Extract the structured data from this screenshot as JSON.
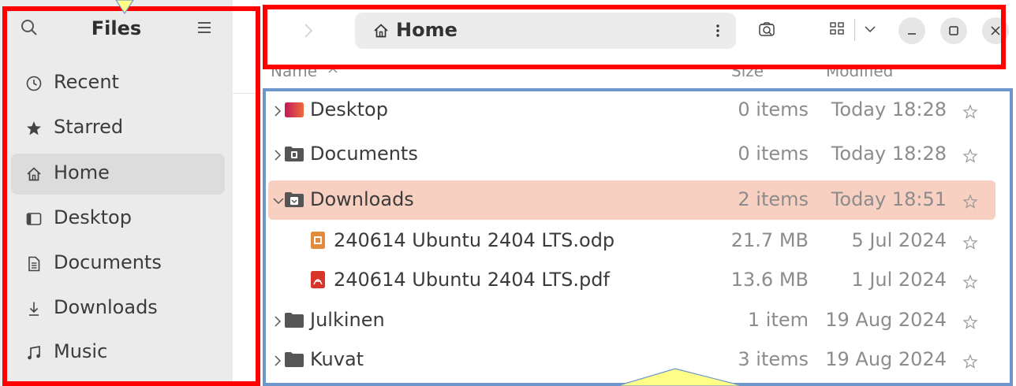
{
  "sidebar": {
    "title": "Files",
    "items": [
      {
        "label": "Recent",
        "icon": "clock-icon"
      },
      {
        "label": "Starred",
        "icon": "star-icon"
      },
      {
        "label": "Home",
        "icon": "home-icon",
        "active": true
      },
      {
        "label": "Desktop",
        "icon": "desktop-icon"
      },
      {
        "label": "Documents",
        "icon": "document-icon"
      },
      {
        "label": "Downloads",
        "icon": "download-icon"
      },
      {
        "label": "Music",
        "icon": "music-icon"
      }
    ]
  },
  "header": {
    "path_label": "Home"
  },
  "columns": {
    "name": "Name",
    "size": "Size",
    "modified": "Modified"
  },
  "files": [
    {
      "name": "Desktop",
      "size": "0 items",
      "modified": "Today 18:28",
      "type": "folder-desktop",
      "expandable": true
    },
    {
      "name": "Documents",
      "size": "0 items",
      "modified": "Today 18:28",
      "type": "folder-documents",
      "expandable": true
    },
    {
      "name": "Downloads",
      "size": "2 items",
      "modified": "Today 18:51",
      "type": "folder-downloads",
      "expandable": true,
      "expanded": true,
      "selected": true
    },
    {
      "name": "240614 Ubuntu 2404 LTS.odp",
      "size": "21.7 MB",
      "modified": "5 Jul 2024",
      "type": "odp-file"
    },
    {
      "name": "240614 Ubuntu 2404 LTS.pdf",
      "size": "13.6 MB",
      "modified": "1 Jul 2024",
      "type": "pdf-file"
    },
    {
      "name": "Julkinen",
      "size": "1 item",
      "modified": "19 Aug 2024",
      "type": "folder",
      "expandable": true
    },
    {
      "name": "Kuvat",
      "size": "3 items",
      "modified": "19 Aug 2024",
      "type": "folder",
      "expandable": true
    }
  ],
  "colors": {
    "selection": "#f7d0c2",
    "annotation_red": "#ff0000",
    "annotation_blue": "#6e96cc",
    "callout_yellow": "#ffff88"
  }
}
